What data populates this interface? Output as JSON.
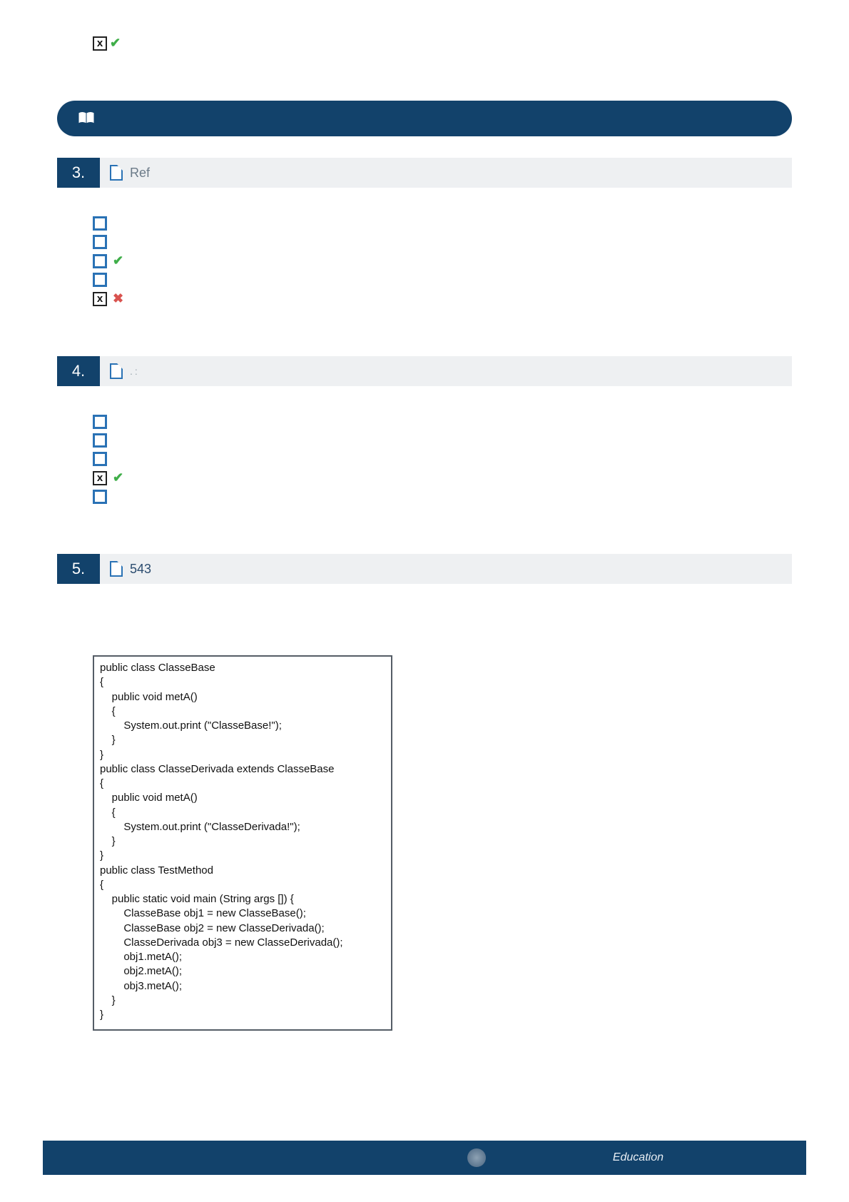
{
  "top_mark": {
    "x": "x",
    "check": "✔"
  },
  "questions": [
    {
      "num": "3.",
      "label": "Ref",
      "answers": [
        {
          "kind": "empty"
        },
        {
          "kind": "empty"
        },
        {
          "kind": "empty",
          "mark": "check"
        },
        {
          "kind": "empty"
        },
        {
          "kind": "x",
          "mark": "cross"
        }
      ]
    },
    {
      "num": "4.",
      "label": ".:",
      "answers": [
        {
          "kind": "empty"
        },
        {
          "kind": "empty"
        },
        {
          "kind": "empty"
        },
        {
          "kind": "x",
          "mark": "check"
        },
        {
          "kind": "empty"
        }
      ]
    },
    {
      "num": "5.",
      "label": "543"
    }
  ],
  "code_text": "public class ClasseBase\n{\n    public void metA()\n    {\n        System.out.print (\"ClasseBase!\");\n    }\n}\npublic class ClasseDerivada extends ClasseBase\n{\n    public void metA()\n    {\n        System.out.print (\"ClasseDerivada!\");\n    }\n}\npublic class TestMethod\n{\n    public static void main (String args []) {\n        ClasseBase obj1 = new ClasseBase();\n        ClasseBase obj2 = new ClasseDerivada();\n        ClasseDerivada obj3 = new ClasseDerivada();\n        obj1.metA();\n        obj2.metA();\n        obj3.metA();\n    }\n}",
  "footer": {
    "text": "Education"
  },
  "glyphs": {
    "check": "✔",
    "cross": "✖",
    "x": "x"
  }
}
